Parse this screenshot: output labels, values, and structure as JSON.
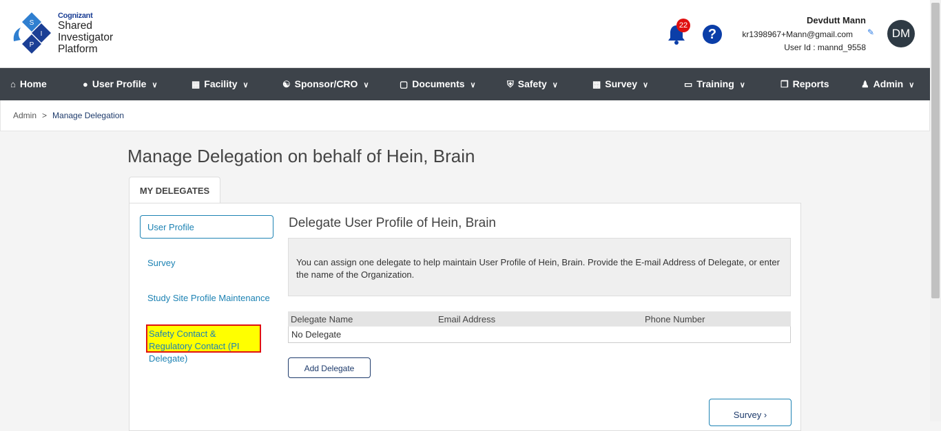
{
  "logo": {
    "brand": "Cognizant",
    "line1": "Shared",
    "line2": "Investigator",
    "line3": "Platform",
    "letters": [
      "S",
      "I",
      "P"
    ]
  },
  "header": {
    "notification_count": "22",
    "help_label": "?",
    "user_name": "Devdutt Mann",
    "user_email": "kr1398967+Mann@gmail.com",
    "user_id": "User Id : mannd_9558",
    "avatar_initials": "DM"
  },
  "nav": {
    "items": [
      {
        "label": "Home",
        "icon": "home-icon"
      },
      {
        "label": "User Profile",
        "icon": "user-circle-icon"
      },
      {
        "label": "Facility",
        "icon": "building-icon"
      },
      {
        "label": "Sponsor/CRO",
        "icon": "users-icon"
      },
      {
        "label": "Documents",
        "icon": "file-icon"
      },
      {
        "label": "Safety",
        "icon": "shield-icon"
      },
      {
        "label": "Survey",
        "icon": "bar-chart-icon"
      },
      {
        "label": "Training",
        "icon": "laptop-icon"
      },
      {
        "label": "Reports",
        "icon": "copy-icon"
      },
      {
        "label": "Admin",
        "icon": "user-icon"
      }
    ]
  },
  "breadcrumb": {
    "root": "Admin",
    "separator": ">",
    "current": "Manage Delegation"
  },
  "page": {
    "title": "Manage Delegation on behalf of Hein, Brain",
    "tab": "MY DELEGATES"
  },
  "sidebar": {
    "items": [
      {
        "label": "User Profile"
      },
      {
        "label": "Survey"
      },
      {
        "label": "Study Site Profile Maintenance"
      },
      {
        "label": "Safety Contact & Regulatory Contact (PI Delegate)"
      }
    ]
  },
  "content": {
    "title": "Delegate User Profile of Hein, Brain",
    "info": "You can assign one delegate to help maintain User Profile of Hein, Brain. Provide the E-mail Address of Delegate, or enter the name of the Organization.",
    "table": {
      "headers": [
        "Delegate Name",
        "Email Address",
        "Phone Number"
      ],
      "empty_row": "No Delegate"
    },
    "add_button": "Add Delegate",
    "next_button": "Survey ›"
  },
  "colors": {
    "nav_bg": "#3d434a",
    "accent": "#1c82b3",
    "brand_blue": "#0b3ea8",
    "badge": "#e01010",
    "highlight": "#ffff00"
  }
}
